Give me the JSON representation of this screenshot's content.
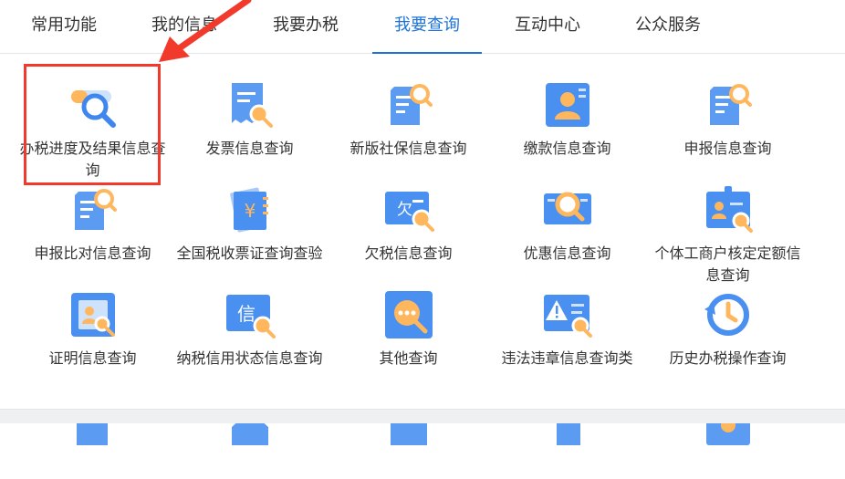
{
  "tabs": [
    {
      "label": "常用功能",
      "active": false
    },
    {
      "label": "我的信息",
      "active": false
    },
    {
      "label": "我要办税",
      "active": false
    },
    {
      "label": "我要查询",
      "active": true
    },
    {
      "label": "互动中心",
      "active": false
    },
    {
      "label": "公众服务",
      "active": false
    }
  ],
  "colors": {
    "accent": "#1e73d8",
    "icon_blue": "#4a90f0",
    "icon_orange": "#ffb75e",
    "annotation_red": "#f23a2c"
  },
  "items": [
    {
      "label": "办税进度及结果信息查询",
      "icon": "progress-search-icon"
    },
    {
      "label": "发票信息查询",
      "icon": "invoice-search-icon"
    },
    {
      "label": "新版社保信息查询",
      "icon": "social-security-search-icon"
    },
    {
      "label": "缴款信息查询",
      "icon": "payment-profile-icon"
    },
    {
      "label": "申报信息查询",
      "icon": "declaration-search-icon"
    },
    {
      "label": "申报比对信息查询",
      "icon": "declaration-compare-icon"
    },
    {
      "label": "全国税收票证查询查验",
      "icon": "tax-voucher-icon"
    },
    {
      "label": "欠税信息查询",
      "icon": "tax-arrears-icon"
    },
    {
      "label": "优惠信息查询",
      "icon": "preferential-search-icon"
    },
    {
      "label": "个体工商户核定定额信息查询",
      "icon": "business-quota-icon"
    },
    {
      "label": "证明信息查询",
      "icon": "certificate-icon"
    },
    {
      "label": "纳税信用状态信息查询",
      "icon": "credit-status-icon"
    },
    {
      "label": "其他查询",
      "icon": "more-query-icon"
    },
    {
      "label": "违法违章信息查询类",
      "icon": "violation-warning-icon"
    },
    {
      "label": "历史办税操作查询",
      "icon": "history-icon"
    }
  ],
  "annotation": {
    "highlighted_item": "办税进度及结果信息查询"
  }
}
